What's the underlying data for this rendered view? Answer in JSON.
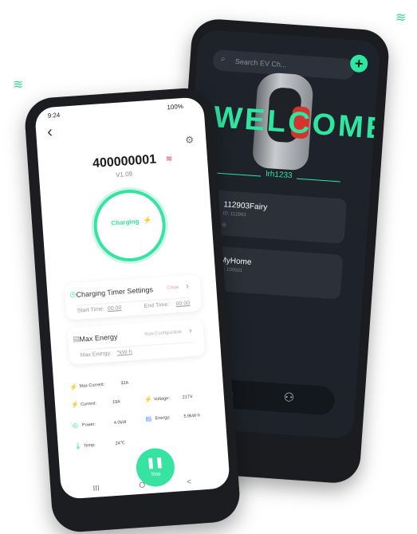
{
  "back_app": {
    "search_placeholder": "Search EV Ch...",
    "plus": "+",
    "welcome": "WELCOME",
    "user": "lrh1233",
    "devices": [
      {
        "name": "112903Fairy",
        "id": "ID: 112903"
      },
      {
        "name": "MyHome",
        "id": "ID: 100501"
      }
    ],
    "tab_home": "⌂",
    "tab_user": "⚇"
  },
  "front_app": {
    "time": "9:24",
    "battery": "100%",
    "back": "‹",
    "device_id": "400000001",
    "version": "V1.09",
    "status": "Charging",
    "timer_title": "Charging Timer Settings",
    "timer_link": "Close",
    "start_label": "Start Time:",
    "start_value": "00:00",
    "end_label": "End Time:",
    "end_value": "00:00",
    "energy_title": "Max Energy",
    "energy_link": "Non-Configurable",
    "energy_label": "Max Energy:",
    "energy_value": "*kW·h",
    "stats": {
      "max_current_label": "Max Current:",
      "max_current": "32A",
      "current_label": "Current:",
      "current": "19A",
      "voltage_label": "Voltage:",
      "voltage": "217V",
      "power_label": "Power:",
      "power": "4.0kW",
      "energy_label": "Energy:",
      "energy": "5.9kW·h",
      "temp_label": "Temp:",
      "temp": "24℃"
    },
    "stop_label": "Stop",
    "nav": [
      "III",
      "O",
      "<"
    ]
  },
  "colors": {
    "accent": "#36e3a0",
    "back_bg": "#1e232b",
    "red": "#e0393e"
  },
  "icons": [
    "wifi-icon",
    "search-icon",
    "plus-icon",
    "home-icon",
    "user-icon",
    "gear-icon",
    "back-arrow-icon",
    "clock-icon",
    "energy-icon",
    "current-icon",
    "voltage-icon",
    "power-icon",
    "temp-icon",
    "pause-icon"
  ]
}
